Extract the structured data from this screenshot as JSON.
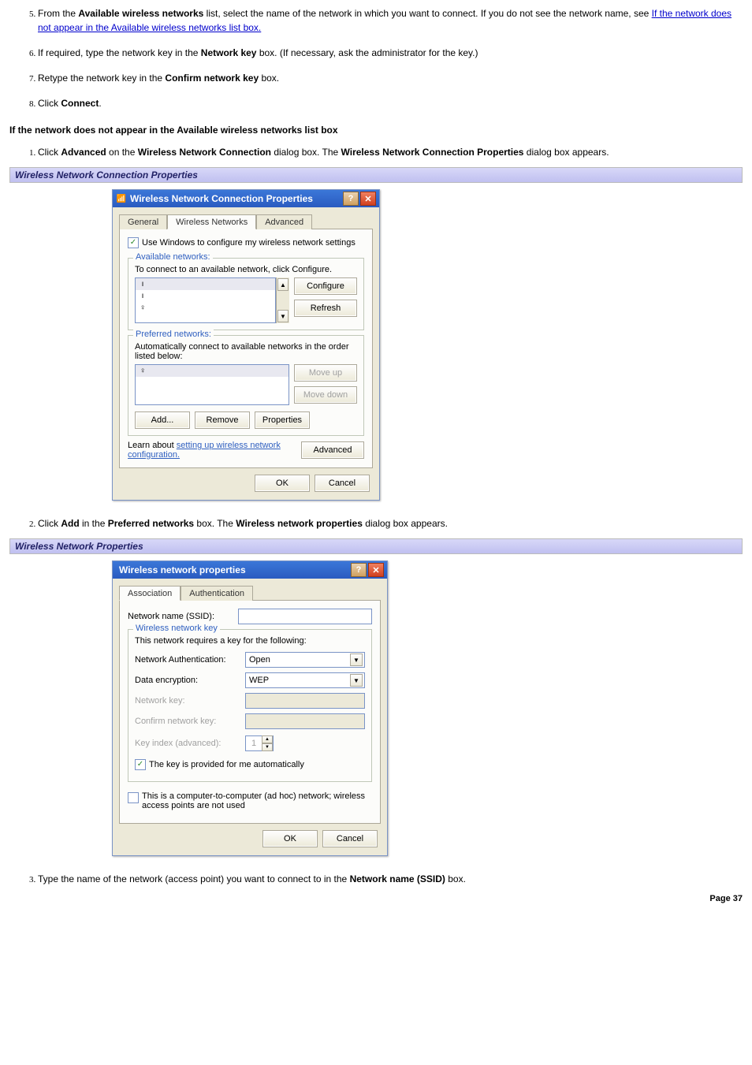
{
  "steps_top": {
    "5": {
      "prefix": "From the ",
      "b1": "Available wireless networks",
      "mid": " list, select the name of the network in which you want to connect. If you do not see the network name, see ",
      "link": "If the network does not appear in the Available wireless networks list box."
    },
    "6": {
      "prefix": "If required, type the network key in the ",
      "b1": "Network key",
      "suffix": " box. (If necessary, ask the administrator for the key.)"
    },
    "7": {
      "prefix": "Retype the network key in the ",
      "b1": "Confirm network key",
      "suffix": " box."
    },
    "8": {
      "prefix": "Click ",
      "b1": "Connect",
      "suffix": "."
    }
  },
  "heading1": "If the network does not appear in the Available wireless networks list box",
  "sub1": {
    "1": {
      "p1": "Click ",
      "b1": "Advanced",
      "p2": " on the ",
      "b2": "Wireless Network Connection",
      "p3": " dialog box. The ",
      "b3": "Wireless Network Connection Properties",
      "p4": " dialog box appears."
    },
    "2": {
      "p1": "Click ",
      "b1": "Add",
      "p2": " in the ",
      "b2": "Preferred networks",
      "p3": " box. The ",
      "b3": "Wireless network properties",
      "p4": " dialog box appears."
    },
    "3": {
      "p1": "Type the name of the network (access point) you want to connect to in the ",
      "b1": "Network name (SSID)",
      "p2": " box."
    }
  },
  "caption1": "Wireless Network Connection Properties",
  "caption2": "Wireless Network Properties",
  "page_label": "Page 37",
  "dlg1": {
    "title": "Wireless Network Connection Properties",
    "tabs": {
      "general": "General",
      "wireless": "Wireless Networks",
      "advanced": "Advanced"
    },
    "use_windows": "Use Windows to configure my wireless network settings",
    "available_legend": "Available networks:",
    "available_text": "To connect to an available network, click Configure.",
    "btn_configure": "Configure",
    "btn_refresh": "Refresh",
    "preferred_legend": "Preferred networks:",
    "preferred_text": "Automatically connect to available networks in the order listed below:",
    "btn_moveup": "Move up",
    "btn_movedown": "Move down",
    "btn_add": "Add...",
    "btn_remove": "Remove",
    "btn_properties": "Properties",
    "learn1": "Learn about ",
    "learn_link": "setting up wireless network configuration.",
    "btn_advanced": "Advanced",
    "btn_ok": "OK",
    "btn_cancel": "Cancel"
  },
  "dlg2": {
    "title": "Wireless network properties",
    "tabs": {
      "assoc": "Association",
      "auth": "Authentication"
    },
    "ssid_label": "Network name (SSID):",
    "key_legend": "Wireless network key",
    "key_text": "This network requires a key for the following:",
    "auth_label": "Network Authentication:",
    "auth_value": "Open",
    "enc_label": "Data encryption:",
    "enc_value": "WEP",
    "netkey_label": "Network key:",
    "confirm_label": "Confirm network key:",
    "keyidx_label": "Key index (advanced):",
    "keyidx_value": "1",
    "autokey": "The key is provided for me automatically",
    "adhoc": "This is a computer-to-computer (ad hoc) network; wireless access points are not used",
    "btn_ok": "OK",
    "btn_cancel": "Cancel"
  }
}
